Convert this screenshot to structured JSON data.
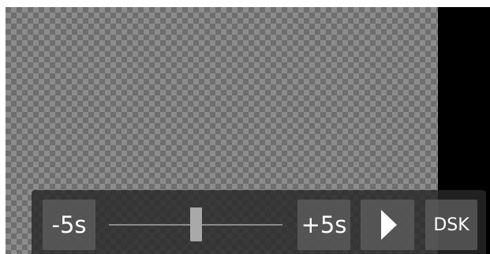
{
  "player": {
    "rewind_label": "-5s",
    "forward_label": "+5s",
    "dsk_label": "DSK",
    "play_icon": "play-icon",
    "seek_position_fraction": 0.5
  },
  "colors": {
    "preview_dark": "#6e6e6e",
    "preview_light": "#8c8c8c",
    "controls_bg": "#282828",
    "button_bg": "#5f5f5f",
    "track": "#8a8a8a",
    "thumb": "#a9a9a9",
    "text": "#ffffff"
  }
}
